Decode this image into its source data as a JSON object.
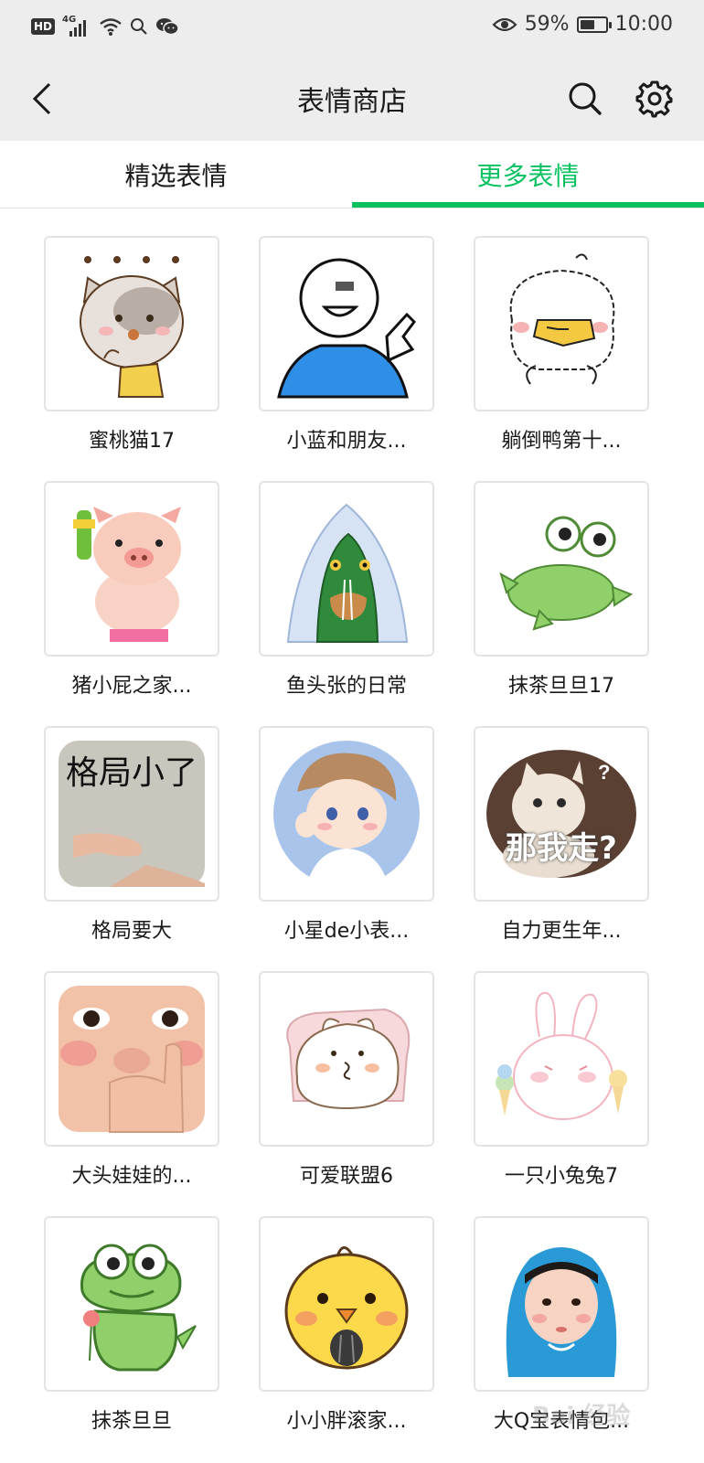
{
  "status_bar": {
    "hd": "HD",
    "network": "4G",
    "battery": "59%",
    "time": "10:00",
    "battery_level": 0.59
  },
  "nav": {
    "title": "表情商店",
    "back_icon": "chevron-left-icon",
    "search_icon": "search-icon",
    "settings_icon": "gear-icon"
  },
  "tabs": [
    {
      "label": "精选表情",
      "active": false
    },
    {
      "label": "更多表情",
      "active": true
    }
  ],
  "accent_color": "#07c160",
  "stickers": [
    {
      "label": "蜜桃猫17",
      "icon": "peach-cat-icon"
    },
    {
      "label": "小蓝和朋友...",
      "icon": "blue-guy-icon"
    },
    {
      "label": "躺倒鸭第十...",
      "icon": "duck-icon"
    },
    {
      "label": "猪小屁之家...",
      "icon": "pig-icon"
    },
    {
      "label": "鱼头张的日常",
      "icon": "fish-head-icon"
    },
    {
      "label": "抹茶旦旦17",
      "icon": "frog-icon"
    },
    {
      "label": "格局要大",
      "icon": "photo-hand-icon",
      "overlay": "格局小了"
    },
    {
      "label": "小星de小表...",
      "icon": "anime-boy-icon"
    },
    {
      "label": "自力更生年...",
      "icon": "cat-photo-icon",
      "overlay": "那我走?"
    },
    {
      "label": "大头娃娃的...",
      "icon": "face-photo-icon"
    },
    {
      "label": "可爱联盟6",
      "icon": "cute-bear-icon"
    },
    {
      "label": "一只小兔兔7",
      "icon": "bunny-icon"
    },
    {
      "label": "抹茶旦旦",
      "icon": "frog-flower-icon"
    },
    {
      "label": "小小胖滚家...",
      "icon": "chick-icon"
    },
    {
      "label": "大Q宝表情包...",
      "icon": "baby-photo-icon"
    }
  ],
  "watermark": "Bai 经验"
}
